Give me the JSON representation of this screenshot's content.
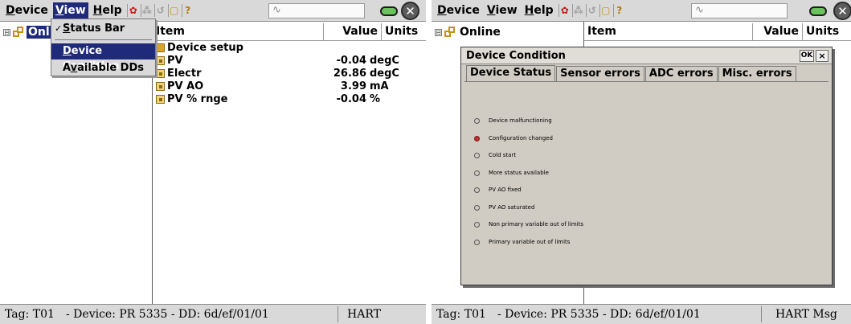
{
  "left": {
    "menus": [
      {
        "mn": "D",
        "rest": "evice"
      },
      {
        "mn": "V",
        "rest": "iew"
      },
      {
        "mn": "H",
        "rest": "elp"
      }
    ],
    "tree_root": "Online",
    "tree_root_visible": "Onl",
    "dropdown": {
      "status_bar": {
        "mn": "S",
        "rest": "tatus Bar",
        "checked": true
      },
      "device_condition": {
        "mn": "D",
        "rest": "evice Condition"
      },
      "available_dds": {
        "a": "A",
        "mn": "v",
        "rest": "ailable DDs"
      }
    },
    "columns": {
      "item": "Item",
      "value": "Value",
      "units": "Units"
    },
    "rows": [
      {
        "label": "Device setup",
        "value": "",
        "units": "",
        "icon": "folder-icon"
      },
      {
        "label": "PV",
        "value": "-0.04",
        "units": "degC",
        "icon": "variable-icon"
      },
      {
        "label": "Electr",
        "value": "26.86",
        "units": "degC",
        "icon": "variable-icon"
      },
      {
        "label": "PV AO",
        "value": "3.99",
        "units": "mA",
        "icon": "variable-icon"
      },
      {
        "label": "PV % rnge",
        "value": "-0.04",
        "units": "%",
        "icon": "variable-icon"
      }
    ],
    "status": {
      "tag": "Tag: T01",
      "device": "- Device: PR 5335 - DD: 6d/ef/01/01",
      "protocol": "HART"
    }
  },
  "right": {
    "menus": [
      {
        "mn": "D",
        "rest": "evice"
      },
      {
        "mn": "V",
        "rest": "iew"
      },
      {
        "mn": "H",
        "rest": "elp"
      }
    ],
    "tree_root": "Online",
    "columns": {
      "item": "Item",
      "value": "Value",
      "units": "Units"
    },
    "dialog": {
      "title": "Device Condition",
      "ok": "OK",
      "close": "×",
      "tabs": [
        "Device Status",
        "Sensor errors",
        "ADC errors",
        "Misc. errors"
      ],
      "active_tab": "Device Status",
      "conditions": [
        {
          "label": "Device malfunctioning",
          "active": false
        },
        {
          "label": "Configuration changed",
          "active": true
        },
        {
          "label": "Cold start",
          "active": false
        },
        {
          "label": "More status available",
          "active": false
        },
        {
          "label": "PV AO fixed",
          "active": false
        },
        {
          "label": "PV AO saturated",
          "active": false
        },
        {
          "label": "Non primary variable out of limits",
          "active": false
        },
        {
          "label": "Primary variable out of limits",
          "active": false
        }
      ]
    },
    "status": {
      "tag": "Tag: T01",
      "device": "- Device: PR 5335 - DD: 6d/ef/01/01",
      "protocol": "HART Msg"
    }
  },
  "colors": {
    "selection": "#1f2a7a",
    "chrome": "#d9d9d9",
    "dialog_bg": "#d0ccc4",
    "led_active": "#c63030",
    "min_button": "#6cc25c"
  }
}
